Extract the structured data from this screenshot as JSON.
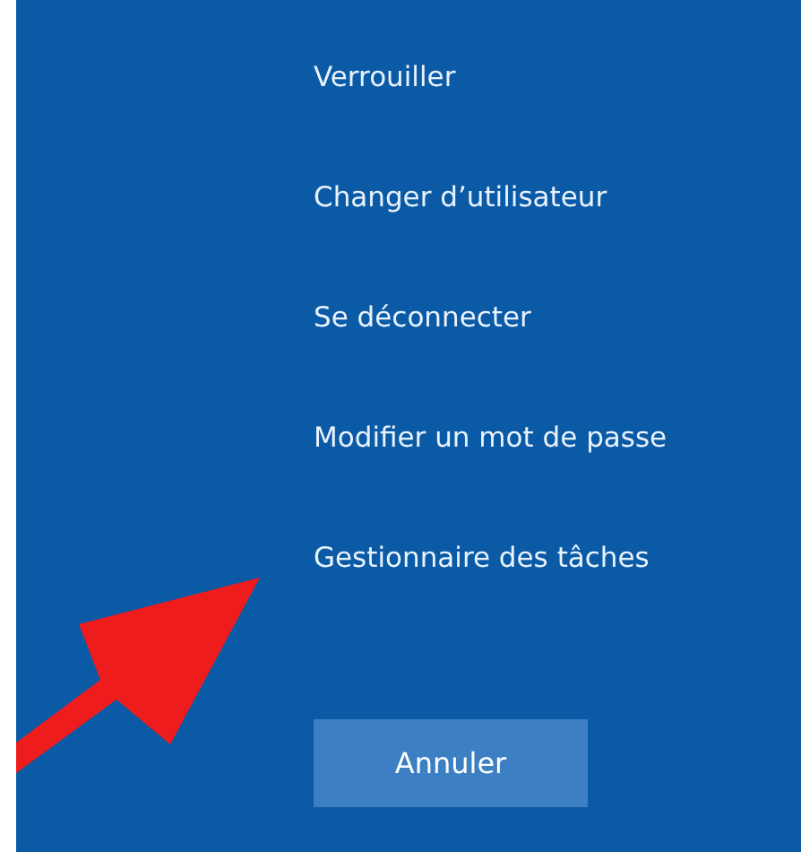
{
  "menu": {
    "items": [
      {
        "label": "Verrouiller"
      },
      {
        "label": "Changer d’utilisateur"
      },
      {
        "label": "Se déconnecter"
      },
      {
        "label": "Modifier un mot de passe"
      },
      {
        "label": "Gestionnaire des tâches"
      }
    ]
  },
  "cancel_button": {
    "label": "Annuler"
  }
}
